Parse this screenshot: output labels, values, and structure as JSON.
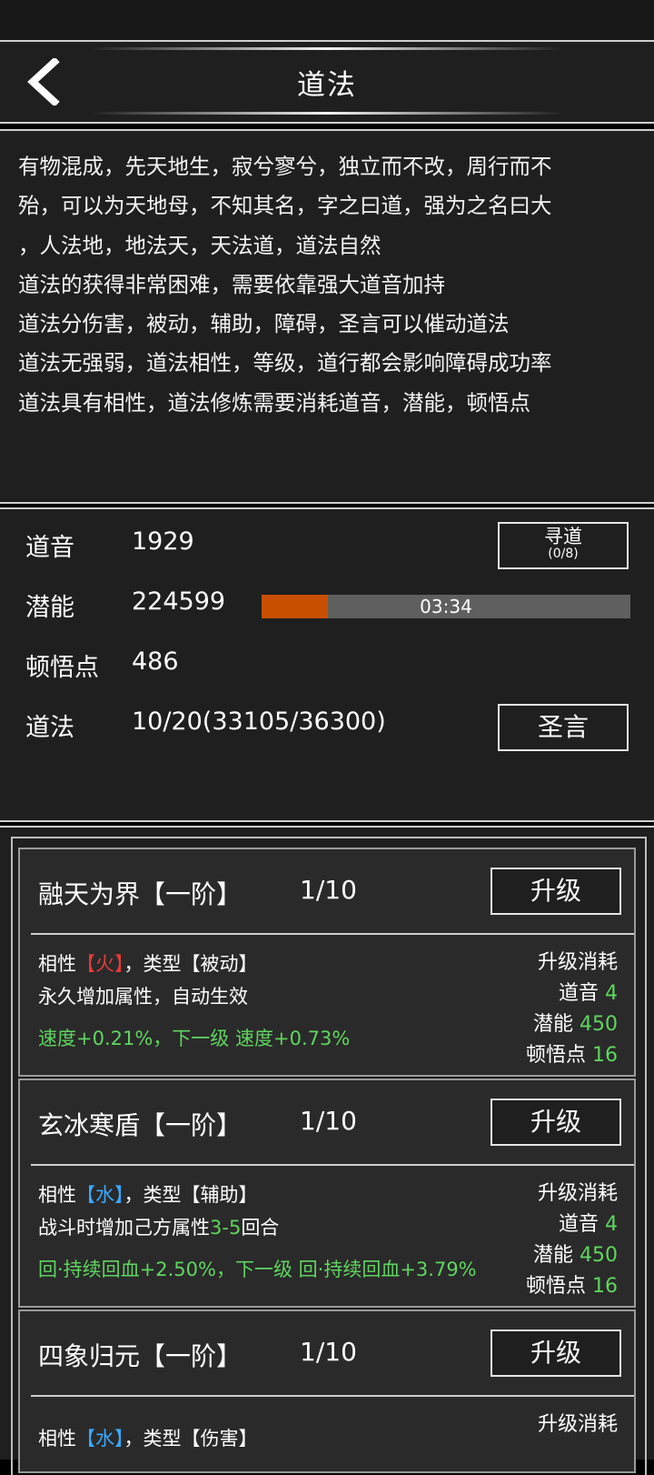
{
  "header": {
    "title": "道法",
    "back_icon": "chevron-left-icon"
  },
  "description": {
    "lines": [
      "有物混成，先天地生，寂兮寥兮，独立而不改，周行而不",
      "殆，可以为天地母，不知其名，字之曰道，强为之名曰大",
      "，人法地，地法天，天法道，道法自然",
      "道法的获得非常困难，需要依靠强大道音加持",
      "道法分伤害，被动，辅助，障碍，圣言可以催动道法",
      "道法无强弱，道法相性，等级，道行都会影响障碍成功率",
      "道法具有相性，道法修炼需要消耗道音，潜能，顿悟点"
    ]
  },
  "stats": {
    "daoyin_label": "道音",
    "daoyin_value": "1929",
    "qianneng_label": "潜能",
    "qianneng_value": "224599",
    "dunwu_label": "顿悟点",
    "dunwu_value": "486",
    "daofa_label": "道法",
    "daofa_value": "10/20(33105/36300)",
    "xundao_label": "寻道",
    "xundao_count": "(0/8)",
    "timer_text": "03:34",
    "timer_progress": 0.18,
    "shengyan_label": "圣言",
    "progress_color": "#c84f00"
  },
  "skills": [
    {
      "name": "融天为界【一阶】",
      "level": "1/10",
      "upgrade_label": "升级",
      "affinity_prefix": "相性",
      "affinity": "【火】",
      "type_text": "，类型【被动】",
      "line2_a": "永久增加属性，自动生效",
      "line2_green": "",
      "line2_b": "",
      "line3": "速度+0.21%，下一级 速度+0.73%",
      "cost_title": "升级消耗",
      "cost_daoyin_label": "道音",
      "cost_daoyin": "4",
      "cost_qianneng_label": "潜能",
      "cost_qianneng": "450",
      "cost_dunwu_label": "顿悟点",
      "cost_dunwu": "16"
    },
    {
      "name": "玄冰寒盾【一阶】",
      "level": "1/10",
      "upgrade_label": "升级",
      "affinity_prefix": "相性",
      "affinity": "【水】",
      "type_text": "，类型【辅助】",
      "line2_a": "战斗时增加己方属性",
      "line2_green": "3-5",
      "line2_b": "回合",
      "line3": "回·持续回血+2.50%，下一级 回·持续回血+3.79%",
      "cost_title": "升级消耗",
      "cost_daoyin_label": "道音",
      "cost_daoyin": "4",
      "cost_qianneng_label": "潜能",
      "cost_qianneng": "450",
      "cost_dunwu_label": "顿悟点",
      "cost_dunwu": "16"
    },
    {
      "name": "四象归元【一阶】",
      "level": "1/10",
      "upgrade_label": "升级",
      "affinity_prefix": "相性",
      "affinity": "【水】",
      "type_text": "，类型【伤害】",
      "cost_title": "升级消耗"
    }
  ]
}
